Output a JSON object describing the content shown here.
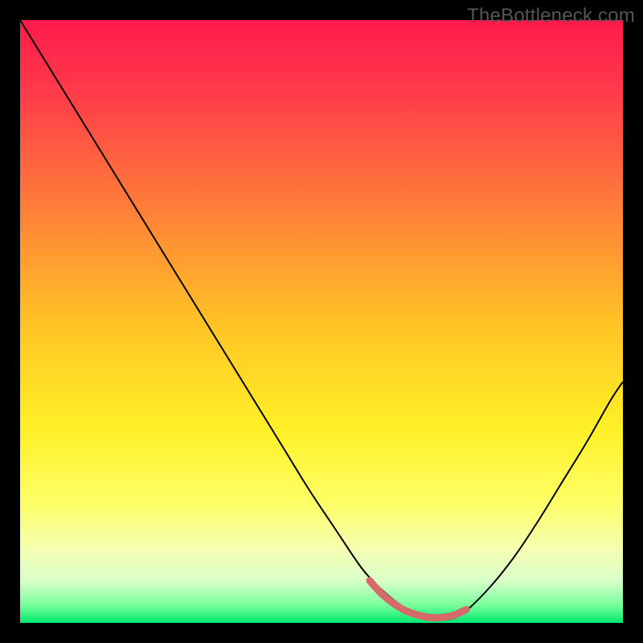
{
  "watermark": "TheBottleneck.com",
  "chart_data": {
    "type": "line",
    "title": "",
    "xlabel": "",
    "ylabel": "",
    "xlim": [
      0,
      100
    ],
    "ylim": [
      0,
      100
    ],
    "grid": false,
    "legend": false,
    "background": {
      "type": "vertical-gradient",
      "stops": [
        {
          "offset": 0.0,
          "color": "#ff1a4b"
        },
        {
          "offset": 0.12,
          "color": "#ff3b4a"
        },
        {
          "offset": 0.3,
          "color": "#ff7a3a"
        },
        {
          "offset": 0.5,
          "color": "#ffc225"
        },
        {
          "offset": 0.68,
          "color": "#fff127"
        },
        {
          "offset": 0.8,
          "color": "#fdff66"
        },
        {
          "offset": 0.88,
          "color": "#f4ffb4"
        },
        {
          "offset": 0.93,
          "color": "#d8ffc8"
        },
        {
          "offset": 0.97,
          "color": "#7aff9c"
        },
        {
          "offset": 1.0,
          "color": "#00e96f"
        }
      ]
    },
    "series": [
      {
        "name": "bottleneck-curve",
        "color": "#000000",
        "width": 2,
        "x": [
          0,
          4,
          8,
          12,
          16,
          20,
          24,
          28,
          32,
          36,
          40,
          44,
          48,
          52,
          56,
          58,
          60,
          62,
          64,
          66,
          68,
          70,
          72,
          74,
          78,
          82,
          86,
          90,
          94,
          98,
          100
        ],
        "y": [
          100,
          93.5,
          87,
          80.5,
          74,
          67.5,
          61,
          54.5,
          48,
          41.5,
          35,
          28.5,
          22,
          16,
          10,
          7.5,
          5.5,
          3.8,
          2.4,
          1.4,
          0.8,
          0.5,
          0.8,
          2,
          6,
          11,
          17,
          23.5,
          30,
          37,
          40
        ]
      },
      {
        "name": "ideal-range",
        "color": "#d66a6a",
        "width": 9,
        "linecap": "round",
        "x": [
          58,
          60,
          62,
          64,
          66,
          68,
          70,
          72,
          74
        ],
        "y": [
          7.0,
          4.8,
          3.2,
          2.0,
          1.3,
          0.9,
          0.9,
          1.3,
          2.2
        ]
      }
    ]
  }
}
